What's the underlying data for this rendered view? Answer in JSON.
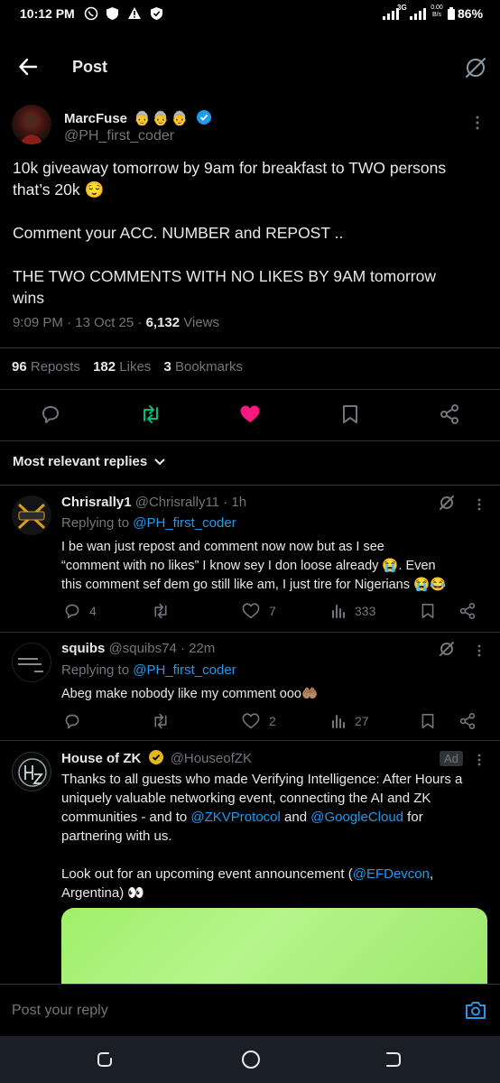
{
  "status": {
    "time": "10:12 PM",
    "net_3g": "3G",
    "net_speed_top": "0.00",
    "net_speed_bottom": "B/s",
    "battery": "86%"
  },
  "header": {
    "title": "Post"
  },
  "post": {
    "author_name": "MarcFuse",
    "author_emojis": "👵👵👵",
    "handle": "@PH_first_coder",
    "text_line1": "10k giveaway tomorrow by 9am for breakfast to TWO persons",
    "text_line2": "that’s 20k 😌",
    "text_line3": "Comment your ACC. NUMBER and REPOST ..",
    "text_line4": "THE  TWO COMMENTS WITH NO LIKES BY 9AM tomorrow",
    "text_line5": "wins",
    "meta_time": "9:09 PM · 13 Oct 25 · ",
    "views_count": "6,132",
    "views_label": " Views",
    "reposts_count": "96",
    "reposts_label": "Reposts",
    "likes_count": "182",
    "likes_label": "Likes",
    "bookmarks_count": "3",
    "bookmarks_label": "Bookmarks"
  },
  "replies_sort": {
    "label": "Most relevant replies"
  },
  "replies": [
    {
      "name": "Chrisrally1",
      "handle": "@Chrisrally11 · 1h",
      "replying_prefix": "Replying to ",
      "replying_to": "@PH_first_coder",
      "line1": "I be wan just repost and comment now now but as I see",
      "line2": "“comment with no likes” I know sey I don loose already 😭. Even",
      "line3": "this comment sef dem go still like am, I just tire for Nigerians 😭😂",
      "replies": "4",
      "reposts": "",
      "likes": "7",
      "views": "333"
    },
    {
      "name": "squibs",
      "handle": "@squibs74 · 22m",
      "replying_prefix": "Replying to ",
      "replying_to": "@PH_first_coder",
      "line1": "Abeg make nobody like my comment ooo🤲🏽",
      "replies": "",
      "reposts": "",
      "likes": "2",
      "views": "27"
    }
  ],
  "ad": {
    "name": "House of ZK",
    "handle": "@HouseofZK",
    "badge": "Ad",
    "line1": "Thanks to all guests who made Verifying Intelligence: After Hours a",
    "line2": "uniquely valuable networking event, connecting the AI and ZK",
    "line3_a": "communities - and to ",
    "line3_link1": "@ZKVProtocol",
    "line3_b": " and ",
    "line3_link2": "@GoogleCloud",
    "line3_c": " for",
    "line4": "partnering with us.",
    "line5_a": "Look out for an upcoming event announcement (",
    "line5_link": "@EFDevcon",
    "line5_b": ",",
    "line6": "Argentina) 👀"
  },
  "composer": {
    "placeholder": "Post your reply"
  },
  "colors": {
    "accent": "#1d9bf0",
    "like": "#f91880",
    "repost": "#00ba7c",
    "muted": "#71767b"
  }
}
